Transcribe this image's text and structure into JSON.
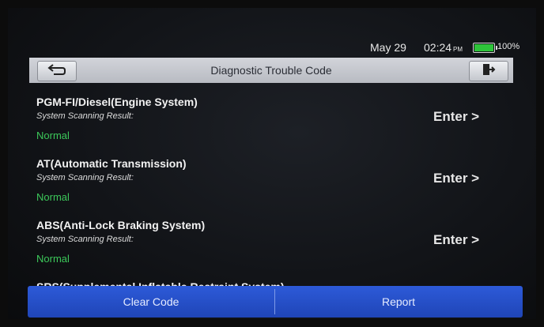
{
  "status": {
    "date": "May 29",
    "time": "02:24",
    "ampm": "PM",
    "battery": "100%"
  },
  "header": {
    "title": "Diagnostic Trouble Code",
    "back_icon": "back-arrow-icon",
    "exit_icon": "exit-door-icon"
  },
  "systems": [
    {
      "name": "PGM-FI/Diesel(Engine System)",
      "subtitle": "System Scanning Result:",
      "status": "Normal",
      "action": "Enter >"
    },
    {
      "name": "AT(Automatic Transmission)",
      "subtitle": "System Scanning Result:",
      "status": "Normal",
      "action": "Enter >"
    },
    {
      "name": "ABS(Anti-Lock Braking System)",
      "subtitle": "System Scanning Result:",
      "status": "Normal",
      "action": "Enter >"
    },
    {
      "name": "SRS(Supplemental Inflatable Restraint System)",
      "subtitle": "",
      "status": "",
      "action": ""
    }
  ],
  "footer": {
    "clear_label": "Clear Code",
    "report_label": "Report"
  },
  "colors": {
    "accent": "#2453d3",
    "status_ok": "#3cc85a"
  }
}
